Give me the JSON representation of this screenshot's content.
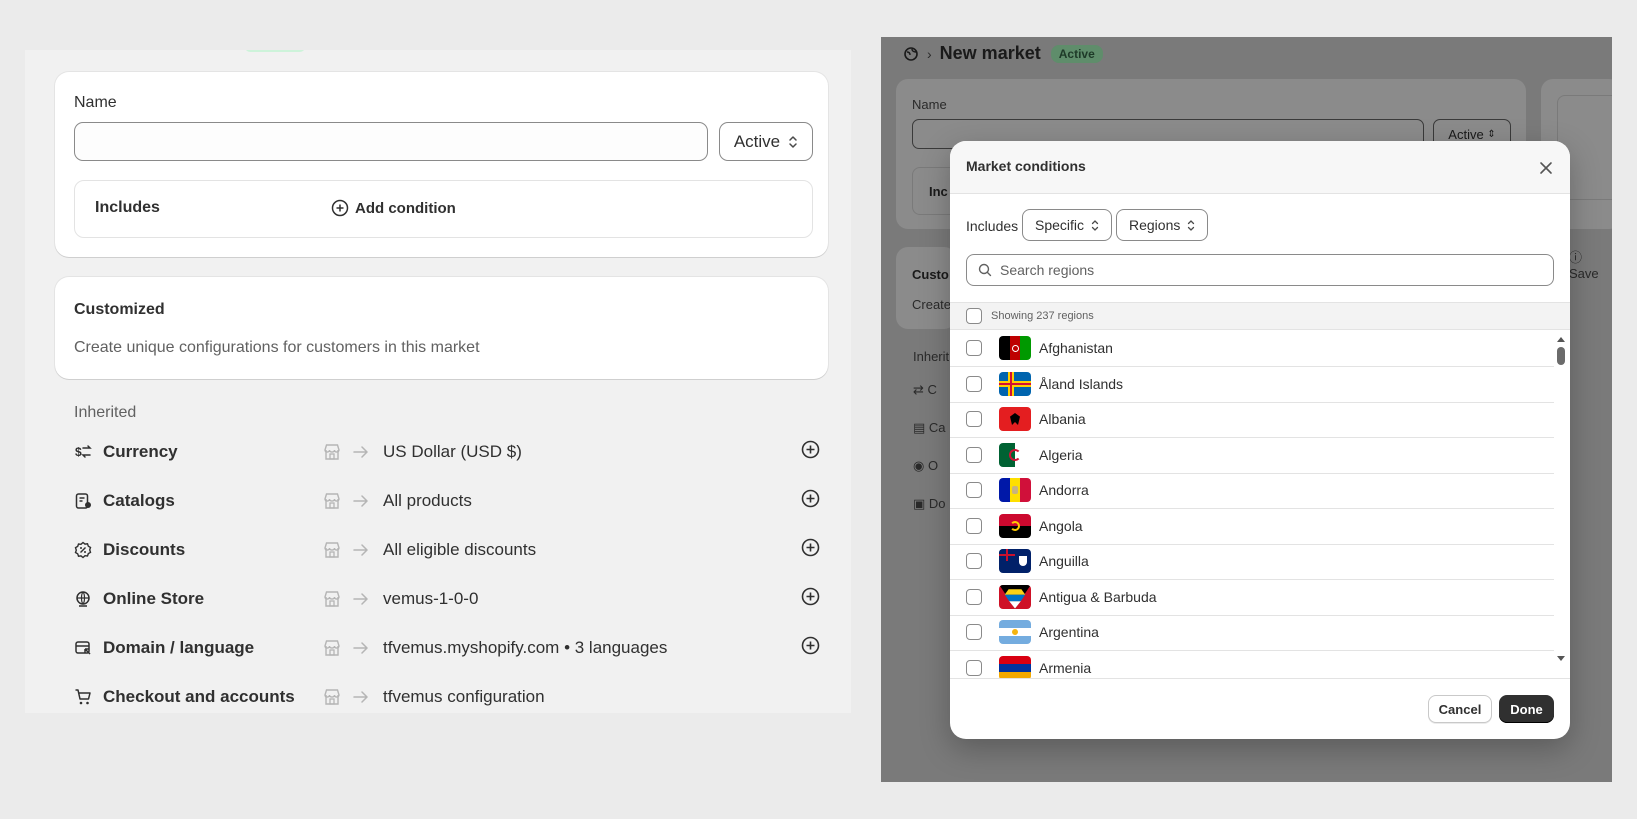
{
  "form": {
    "name_label": "Name",
    "name_value": "",
    "status_select": "Active",
    "includes_label": "Includes",
    "add_condition": "Add condition"
  },
  "customized": {
    "title": "Customized",
    "description": "Create unique configurations for customers in this market"
  },
  "inherited": {
    "title": "Inherited",
    "items": [
      {
        "name": "Currency",
        "value": "US Dollar (USD $)",
        "icon": "currency-exchange-icon"
      },
      {
        "name": "Catalogs",
        "value": "All products",
        "icon": "catalog-icon"
      },
      {
        "name": "Discounts",
        "value": "All eligible discounts",
        "icon": "discount-icon"
      },
      {
        "name": "Online Store",
        "value": "vemus-1-0-0",
        "icon": "online-store-icon"
      },
      {
        "name": "Domain / language",
        "value": "tfvemus.myshopify.com • 3 languages",
        "icon": "domain-icon"
      },
      {
        "name": "Checkout and accounts",
        "value": "tfvemus configuration",
        "icon": "cart-icon"
      }
    ]
  },
  "background_page": {
    "breadcrumb_icon": "markets-icon",
    "title": "New market",
    "status_badge": "Active",
    "name_label": "Name",
    "status_select": "Active",
    "includes_partial": "Inc",
    "customized_partial": "Custo",
    "create_partial": "Create",
    "inherited_partial": "Inherit",
    "save_partial": "Save",
    "row_partials": [
      "C",
      "Ca",
      "O",
      "Do"
    ]
  },
  "modal": {
    "title": "Market conditions",
    "includes_label": "Includes",
    "scope_select": "Specific",
    "type_select": "Regions",
    "search_placeholder": "Search regions",
    "showing_text": "Showing 237 regions",
    "countries": [
      "Afghanistan",
      "Åland Islands",
      "Albania",
      "Algeria",
      "Andorra",
      "Angola",
      "Anguilla",
      "Antigua & Barbuda",
      "Argentina",
      "Armenia"
    ],
    "cancel": "Cancel",
    "done": "Done"
  },
  "colors": {
    "badge_bg": "#b4fed2",
    "badge_text": "#0c5132",
    "primary_button": "#303030"
  }
}
